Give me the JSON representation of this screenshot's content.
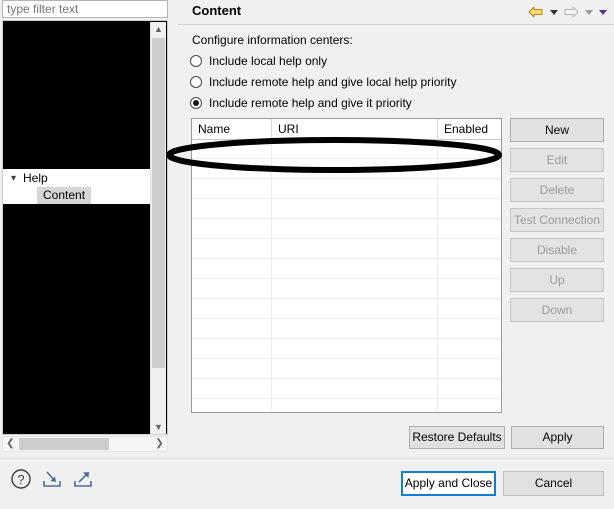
{
  "window": {
    "title": "Content"
  },
  "filter": {
    "placeholder": "type filter text",
    "value": ""
  },
  "tree": {
    "items": [
      {
        "label": "Help",
        "twisty": "chevron-down-icon",
        "selected": false
      },
      {
        "label": "Content",
        "selected": true
      }
    ]
  },
  "header": {
    "title": "Content",
    "nav": [
      {
        "name": "back-arrow-icon",
        "color": "#d9a425"
      },
      {
        "name": "back-dropdown-caret-icon",
        "color": "#333333"
      },
      {
        "name": "forward-arrow-icon",
        "color": "#b0b0b0"
      },
      {
        "name": "forward-dropdown-caret-icon",
        "color": "#9a9a9a"
      },
      {
        "name": "view-menu-caret-icon",
        "color": "#5b2d8e"
      }
    ]
  },
  "content": {
    "group_label": "Configure information centers:",
    "radios": [
      {
        "label": "Include local help only",
        "checked": false
      },
      {
        "label": "Include remote help and give local help priority",
        "checked": false
      },
      {
        "label": "Include remote help and give it priority",
        "checked": true
      }
    ],
    "table": {
      "columns": [
        "Name",
        "URI",
        "Enabled"
      ],
      "rows": [],
      "empty_row_count": 14
    },
    "side_buttons": [
      {
        "label": "New",
        "enabled": true
      },
      {
        "label": "Edit",
        "enabled": false
      },
      {
        "label": "Delete",
        "enabled": false
      },
      {
        "label": "Test Connection",
        "enabled": false
      },
      {
        "label": "Disable",
        "enabled": false
      },
      {
        "label": "Up",
        "enabled": false
      },
      {
        "label": "Down",
        "enabled": false
      }
    ],
    "restore_defaults_label": "Restore Defaults",
    "apply_label": "Apply"
  },
  "bottom_bar": {
    "icons": [
      {
        "name": "help-icon"
      },
      {
        "name": "import-icon"
      },
      {
        "name": "export-icon"
      }
    ],
    "apply_and_close_label": "Apply and Close",
    "cancel_label": "Cancel",
    "focus_color": "#0f7fd4"
  },
  "annotation": {
    "shape": "ellipse",
    "color": "#000000",
    "target": "first-table-row"
  }
}
